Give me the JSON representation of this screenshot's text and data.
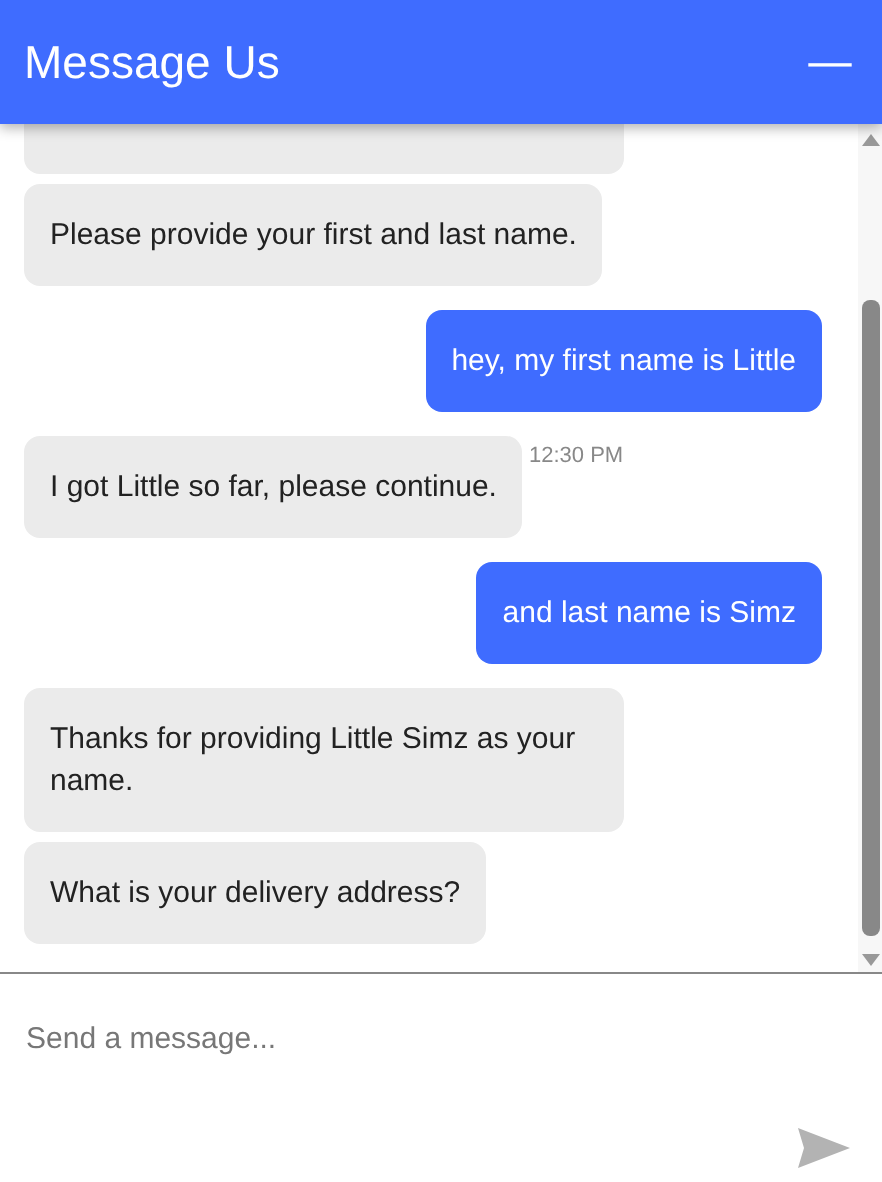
{
  "header": {
    "title": "Message Us",
    "minimize_icon": "—"
  },
  "messages": [
    {
      "kind": "bot"
    },
    {
      "kind": "bot",
      "text": "Please provide your first and last name."
    },
    {
      "kind": "user",
      "text": "hey, my first name is Little"
    },
    {
      "kind": "bot",
      "text": "I got Little so far, please continue.",
      "time": "12:30 PM"
    },
    {
      "kind": "user",
      "text": "and last name is Simz"
    },
    {
      "kind": "bot",
      "text": "Thanks for providing Little Simz as your name."
    },
    {
      "kind": "bot",
      "text": "What is your delivery address?"
    }
  ],
  "composer": {
    "placeholder": "Send a message..."
  }
}
